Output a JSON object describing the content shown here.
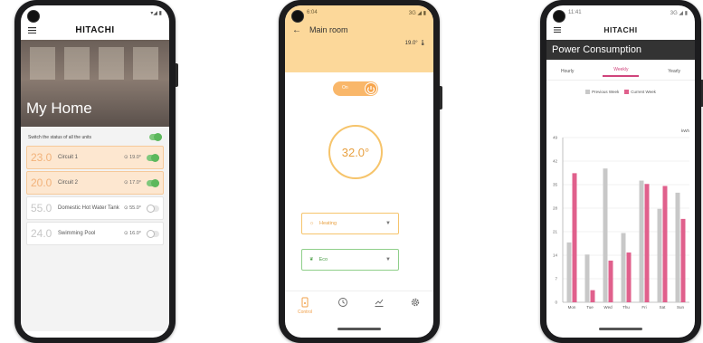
{
  "colors": {
    "accent_orange": "#f6c46b",
    "header_orange": "#fcd89a",
    "eco_green": "#8fcf8a",
    "bar_pink": "#e0608c",
    "bar_gray": "#c8c8c8",
    "banner_dark": "#333333"
  },
  "phone1": {
    "brand": "HITACHI",
    "menu_icon": "hamburger-icon",
    "title": "My Home",
    "switch_all_label": "Switch the status of all the units",
    "units": [
      {
        "temp": "23.0",
        "name": "Circuit 1",
        "setpoint": "19.0°",
        "on": true
      },
      {
        "temp": "20.0",
        "name": "Circuit 2",
        "setpoint": "17.0°",
        "on": true
      },
      {
        "temp": "55.0",
        "name": "Domestic Hot Water Tank",
        "setpoint": "55.0°",
        "on": false
      },
      {
        "temp": "24.0",
        "name": "Swimming Pool",
        "setpoint": "16.0°",
        "on": false
      }
    ]
  },
  "phone2": {
    "status_time": "6:04",
    "status_network": "3G",
    "title": "Main room",
    "setpoint": "19.0°",
    "power_label": "On",
    "current_temp": "32.0°",
    "mode_label": "Heating",
    "eco_label": "Eco",
    "tabs": [
      {
        "label": "Control",
        "icon": "phone-control-icon"
      },
      {
        "label": "",
        "icon": "clock-icon"
      },
      {
        "label": "",
        "icon": "chart-icon"
      },
      {
        "label": "",
        "icon": "gear-icon"
      }
    ]
  },
  "phone3": {
    "status_time": "11:41",
    "status_network": "3G",
    "brand": "HITACHI",
    "menu_icon": "hamburger-icon",
    "banner_title": "Power Consumption",
    "tabs": [
      "Hourly",
      "Weekly",
      "Yearly"
    ],
    "active_tab": "Weekly",
    "chart_data": {
      "type": "bar",
      "categories": [
        "Mon",
        "Tue",
        "Wed",
        "Thu",
        "Fri",
        "Sat",
        "Sun"
      ],
      "series": [
        {
          "name": "Previous Week",
          "color": "#c8c8c8",
          "values": [
            17.8,
            14.2,
            39.8,
            20.6,
            36.2,
            27.8,
            32.6
          ]
        },
        {
          "name": "Current Week",
          "color": "#e0608c",
          "values": [
            38.4,
            3.6,
            12.4,
            14.8,
            35.2,
            34.6,
            24.8
          ]
        }
      ],
      "ylabel": "kWh",
      "yticks": [
        "0",
        "7",
        "14",
        "21",
        "28",
        "35",
        "42",
        "49"
      ],
      "ylim": [
        0,
        49
      ],
      "grid": true,
      "legend_position": "top"
    }
  }
}
